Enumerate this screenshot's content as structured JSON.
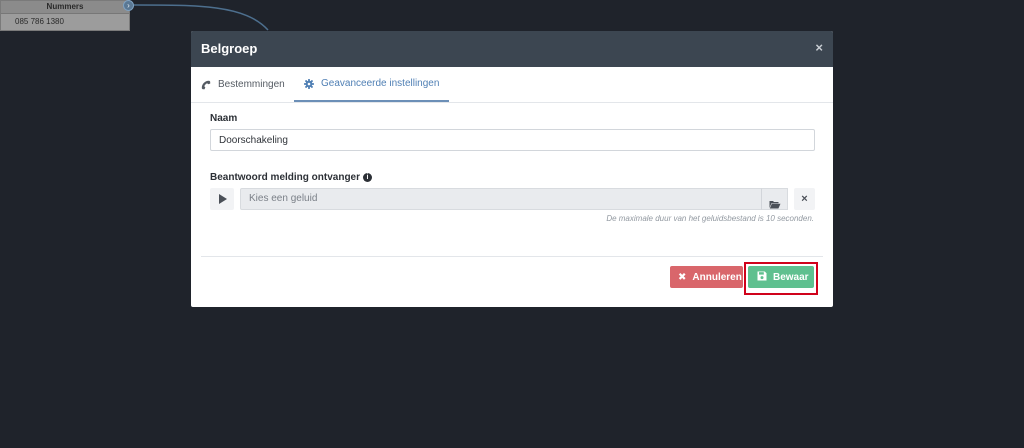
{
  "background": {
    "node_header": "Nummers",
    "node_row": "085 786 1380"
  },
  "modal": {
    "title": "Belgroep",
    "close_glyph": "×",
    "tabs": [
      {
        "label": "Bestemmingen",
        "icon": "phone-icon"
      },
      {
        "label": "Geavanceerde instellingen",
        "icon": "gear-icon",
        "active": true
      }
    ],
    "name_field": {
      "label": "Naam",
      "value": "Doorschakeling"
    },
    "answer_field": {
      "label": "Beantwoord melding ontvanger",
      "info_glyph": "i",
      "placeholder": "Kies een geluid",
      "clear_glyph": "×",
      "hint": "De maximale duur van het geluidsbestand is 10 seconden."
    },
    "buttons": {
      "cancel_label": "Annuleren",
      "cancel_glyph": "✖",
      "save_label": "Bewaar"
    }
  },
  "colors": {
    "header_bg": "#3c4651",
    "active_tab": "#4f7fb4",
    "cancel": "#d9666b",
    "save": "#5fc08f",
    "highlight": "#d0021b"
  }
}
